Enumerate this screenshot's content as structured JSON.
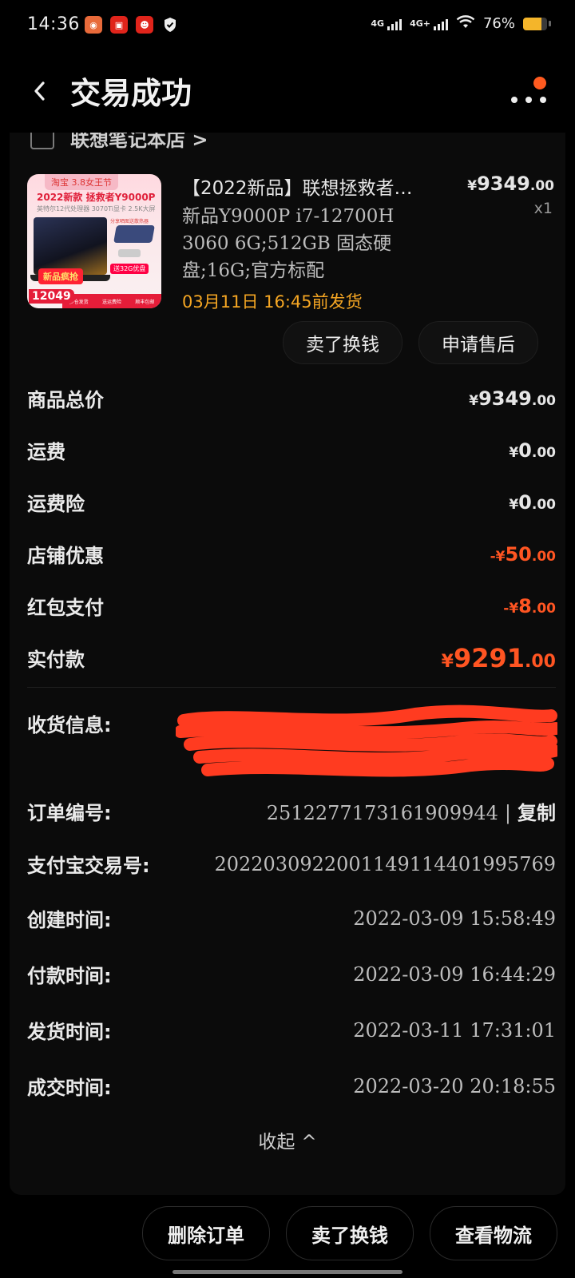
{
  "status_bar": {
    "time": "14:36",
    "network_1": "4G",
    "network_2": "4G+",
    "battery_percent": "76%",
    "battery_level": 0.76
  },
  "header": {
    "title": "交易成功"
  },
  "shop": {
    "name": "联想笔记本店 >"
  },
  "product": {
    "title": "【2022新品】联想拯救者…",
    "price_currency": "¥",
    "price_int": "9349",
    "price_dec": ".00",
    "qty": "x1",
    "sku": "新品Y9000P i7-12700H 3060 6G;512GB 固态硬盘;16G;官方标配",
    "ship_note": "03月11日 16:45前发货",
    "thumb": {
      "tag": "淘宝 3.8女王节",
      "model": "2022新款 拯救者Y9000P",
      "sub": "英特尔12代处理器  3070Ti显卡  2.5K大屏",
      "hot": "新品疯抢",
      "promo_top": "分享晒图送散热器",
      "promo": "送32G优盘",
      "price": "12049",
      "strip_1": "多仓发货",
      "strip_2": "送运费险",
      "strip_3": "顺丰包邮"
    }
  },
  "actions": {
    "sell": "卖了换钱",
    "after_sale": "申请售后"
  },
  "price_rows": [
    {
      "label": "商品总价",
      "cur": "¥",
      "int": "9349",
      "dec": ".00"
    },
    {
      "label": "运费",
      "cur": "¥",
      "int": "0",
      "dec": ".00"
    },
    {
      "label": "运费险",
      "cur": "¥",
      "int": "0",
      "dec": ".00"
    },
    {
      "label": "店铺优惠",
      "cur": "-¥",
      "int": "50",
      "dec": ".00"
    },
    {
      "label": "红包支付",
      "cur": "-¥",
      "int": "8",
      "dec": ".00"
    },
    {
      "label": "实付款",
      "cur": "¥",
      "int": "9291",
      "dec": ".00"
    }
  ],
  "info": {
    "receiver_label": "收货信息:",
    "order_label": "订单编号:",
    "order_value": "2512277173161909944",
    "copy_sep": "|",
    "copy": "复制",
    "alipay_label": "支付宝交易号:",
    "alipay_value": "2022030922001149114401995769",
    "created_label": "创建时间:",
    "created_value": "2022-03-09 15:58:49",
    "paid_label": "付款时间:",
    "paid_value": "2022-03-09 16:44:29",
    "shipped_label": "发货时间:",
    "shipped_value": "2022-03-11 17:31:01",
    "done_label": "成交时间:",
    "done_value": "2022-03-20 20:18:55"
  },
  "collapse": {
    "label": "收起",
    "arrow": "^"
  },
  "bottom": {
    "delete": "删除订单",
    "sell": "卖了换钱",
    "logistics": "查看物流"
  },
  "colors": {
    "accent_red": "#ff5522",
    "ship_orange": "#f5a623",
    "redaction": "#ff3b20"
  }
}
